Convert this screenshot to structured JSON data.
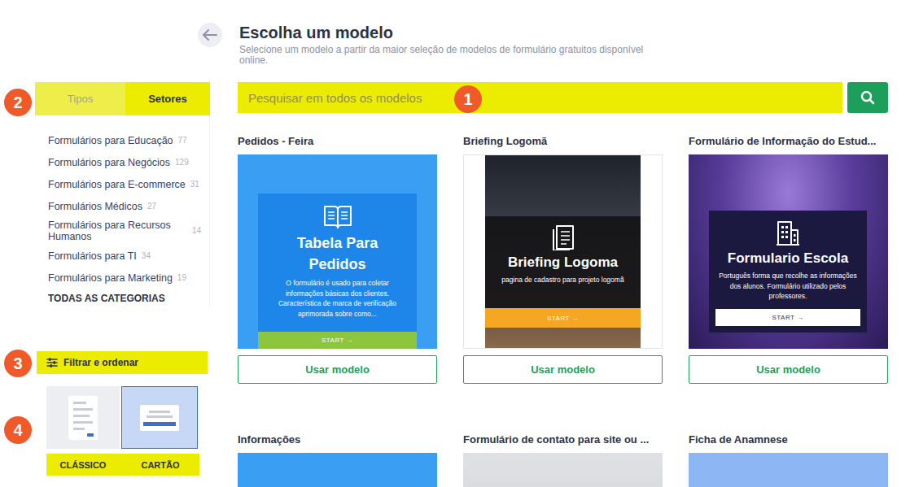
{
  "header": {
    "title": "Escolha um modelo",
    "subtitle": "Selecione um modelo a partir da maior seleção de modelos de formulário gratuitos disponível online."
  },
  "search": {
    "placeholder": "Pesquisar em todos os modelos"
  },
  "annotations": [
    "1",
    "2",
    "3",
    "4"
  ],
  "sidebar": {
    "tabs": [
      {
        "label": "Tipos",
        "selected": false
      },
      {
        "label": "Setores",
        "selected": true
      }
    ],
    "categories": [
      {
        "name": "Formulários para Educação",
        "count": "77"
      },
      {
        "name": "Formulários para Negócios",
        "count": "129"
      },
      {
        "name": "Formulários para E-commerce",
        "count": "31"
      },
      {
        "name": "Formulários Médicos",
        "count": "27"
      },
      {
        "name": "Formulários para Recursos Humanos",
        "count": "14"
      },
      {
        "name": "Formulários para TI",
        "count": "34"
      },
      {
        "name": "Formulários para Marketing",
        "count": "19"
      }
    ],
    "all_categories": "TODAS AS CATEGORIAS",
    "filter": "Filtrar e ordenar",
    "views": [
      {
        "label": "CLÁSSICO",
        "selected": false,
        "kind": "classic"
      },
      {
        "label": "CARTÃO",
        "selected": true,
        "kind": "card"
      }
    ]
  },
  "cards": [
    {
      "title": "Pedidos - Feira",
      "preview": {
        "kind": "blue-form",
        "heading": "Tabela Para Pedidos",
        "description": "O formulário é usado para coletar informações básicas dos clientes. Característica de marca de verificação aprimorada sobre como...",
        "start": "START →"
      },
      "button": "Usar modelo"
    },
    {
      "title": "Briefing Logomã",
      "preview": {
        "kind": "city-form",
        "heading": "Briefing Logoma",
        "description": "pagina de cadastro para projeto logomã",
        "start": "START →"
      },
      "button": "Usar modelo"
    },
    {
      "title": "Formulário de Informação do Estud...",
      "preview": {
        "kind": "concert-form",
        "heading": "Formulario Escola",
        "description": "Português forma que recolhe as informações dos alunos. Formulário utilizado pelos professores.",
        "start": "START →"
      },
      "button": "Usar modelo"
    },
    {
      "title": "Informações",
      "preview": {
        "kind": "plain-blue"
      }
    },
    {
      "title": "Formulário de contato para site ou ...",
      "preview": {
        "kind": "mountain"
      }
    },
    {
      "title": "Ficha de Anamnese",
      "preview": {
        "kind": "light-blue"
      }
    }
  ]
}
